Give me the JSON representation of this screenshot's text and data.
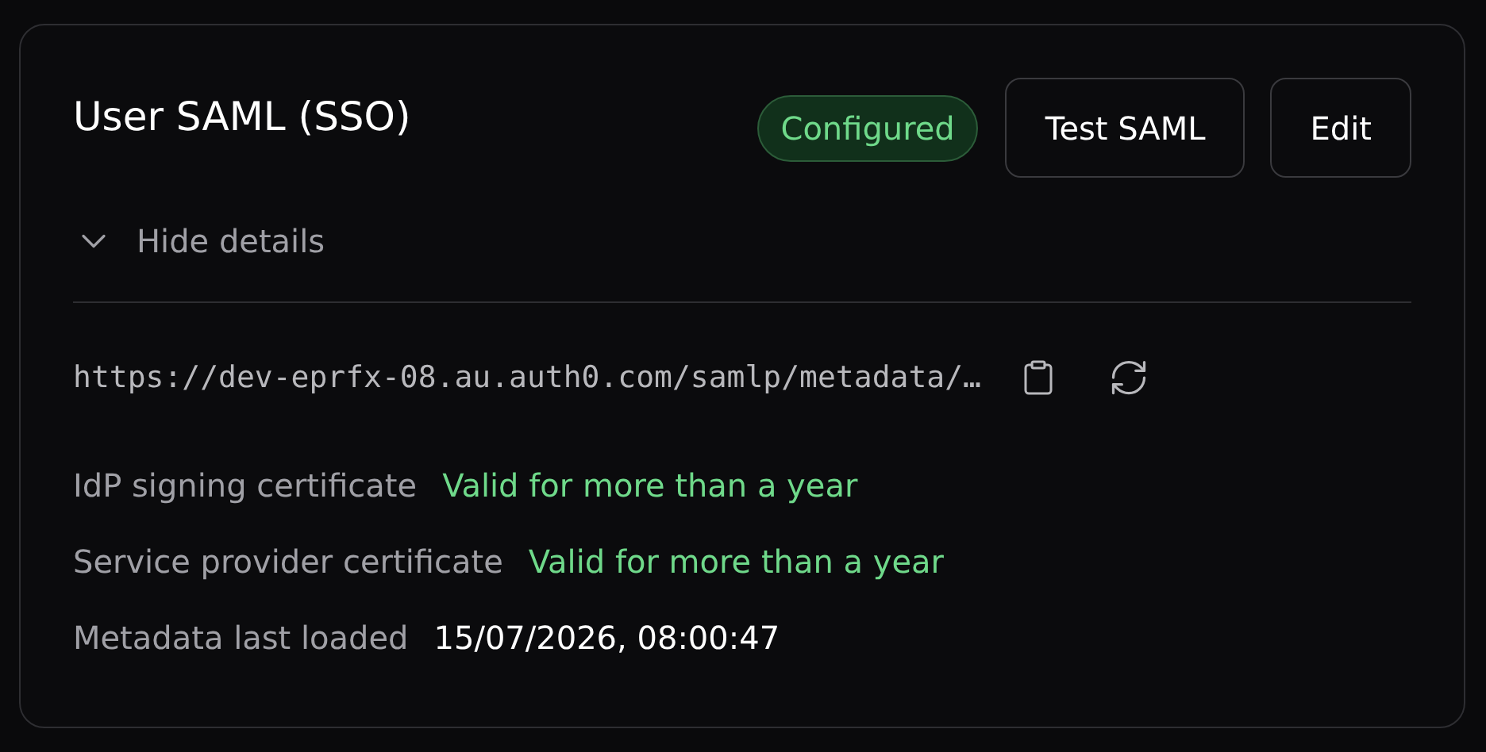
{
  "card": {
    "title": "User SAML (SSO)",
    "badge": "Configured",
    "buttons": [
      "Test SAML",
      "Edit"
    ]
  },
  "details": {
    "toggle": "Hide details",
    "expanded": true
  },
  "metadata_url": "https://dev-eprfx-08.au.auth0.com/samlp/metadata/…",
  "rows": [
    {
      "label": "IdP signing certificate",
      "value": "Valid for more than a year",
      "kind": "status"
    },
    {
      "label": "Service provider certificate",
      "value": "Valid for more than a year",
      "kind": "status"
    },
    {
      "label": "Metadata last loaded",
      "value": "15/07/2026, 08:00:47",
      "kind": "value"
    }
  ]
}
